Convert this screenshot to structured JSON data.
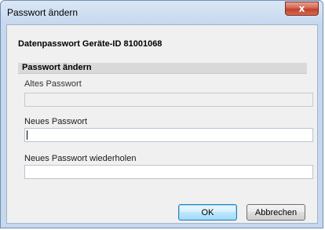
{
  "window": {
    "title": "Passwort ändern",
    "close_glyph": "x"
  },
  "dialog": {
    "heading": "Datenpasswort Geräte-ID 81001068",
    "section_title": "Passwort ändern",
    "fields": {
      "old_password": {
        "label": "Altes Passwort",
        "value": "",
        "enabled": false
      },
      "new_password": {
        "label": "Neues Passwort",
        "value": "",
        "focused": true
      },
      "repeat_password": {
        "label": "Neues Passwort wiederholen",
        "value": ""
      }
    },
    "buttons": {
      "ok": "OK",
      "cancel": "Abbrechen"
    }
  },
  "colors": {
    "title_gradient_top": "#dbe7f5",
    "close_button": "#c2412c",
    "client_bg": "#f0f0f0",
    "section_bar": "#d9d9d9"
  },
  "icons": {
    "close": "close-icon"
  }
}
